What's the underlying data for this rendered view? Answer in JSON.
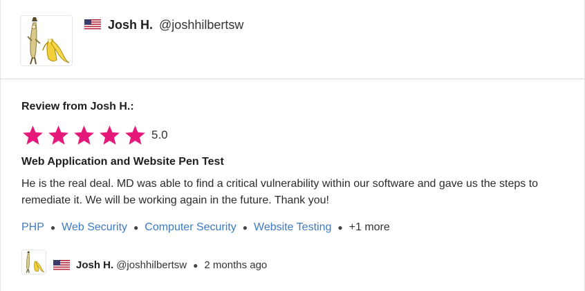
{
  "header": {
    "avatar_icon": "banana-character-avatar",
    "flag_icon": "us-flag-icon",
    "name": "Josh H.",
    "handle": "@joshhilbertsw"
  },
  "review": {
    "heading": "Review from Josh H.:",
    "rating": 5,
    "rating_label": "5.0",
    "star_color": "#e5197a",
    "job_title": "Web Application and Website Pen Test",
    "text": "He is the real deal. MD was able to find a critical vulnerability within our software and gave us the steps to remediate it. We will be working again in the future. Thank you!",
    "tags": [
      "PHP",
      "Web Security",
      "Computer Security",
      "Website Testing"
    ],
    "more_label": "+1 more",
    "link_color": "#3b7ac7"
  },
  "footer": {
    "flag_icon": "us-flag-icon",
    "name": "Josh H.",
    "handle": "@joshhilbertsw",
    "time": "2 months ago"
  }
}
